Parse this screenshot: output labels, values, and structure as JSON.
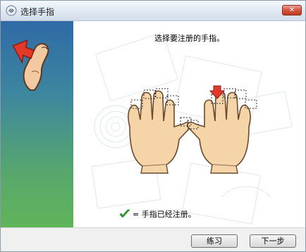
{
  "window": {
    "title": "选择手指",
    "close_label": "✕"
  },
  "main": {
    "instruction": "选择要注册的手指。",
    "legend_text": "= 手指已经注册。"
  },
  "footer": {
    "practice_label": "练习",
    "next_label": "下一步"
  },
  "icons": {
    "app": "fingerprint-icon",
    "sidebar": "finger-press-icon",
    "selection_arrow": "down-arrow-icon",
    "registered": "checkmark-icon"
  },
  "colors": {
    "sidebar_top": "#2f6aa5",
    "sidebar_bottom": "#60b45a",
    "close_red": "#c13b22",
    "selection_arrow": "#d9342b",
    "checkmark": "#3aa33a",
    "skin": "#f5d4a8"
  }
}
